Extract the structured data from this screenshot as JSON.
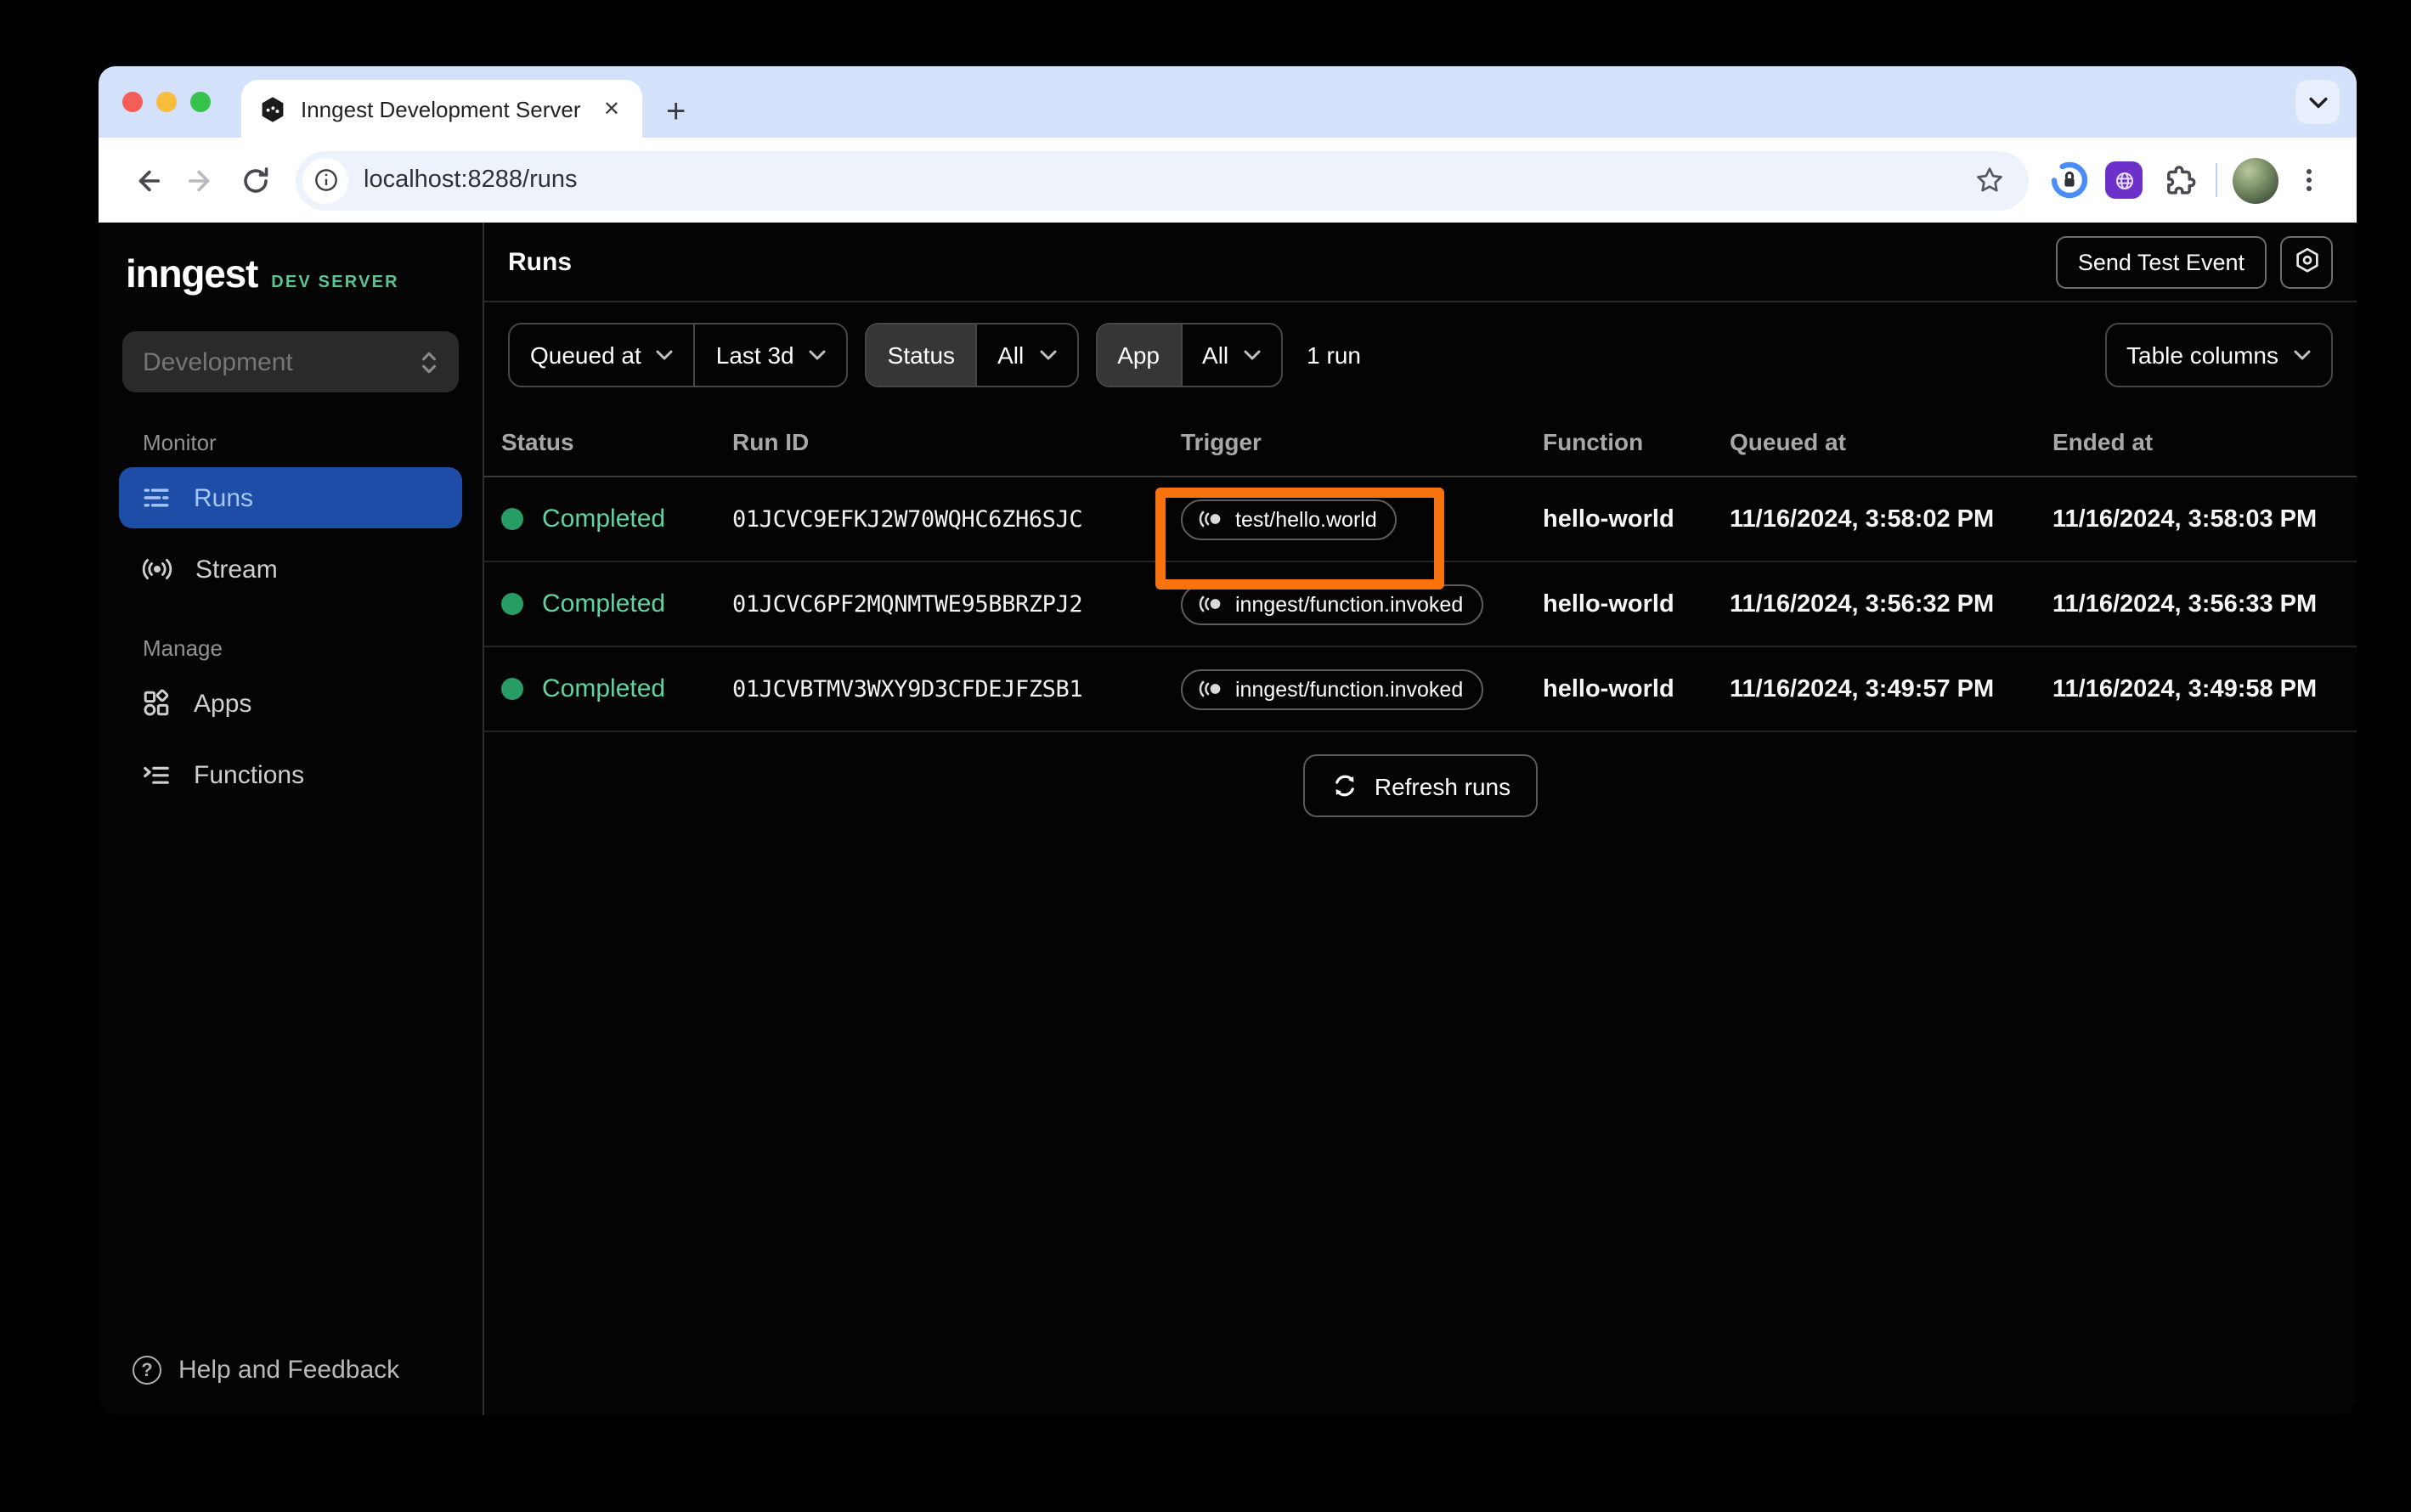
{
  "colors": {
    "accent_orange": "#f8730e",
    "active_item_blue": "#1d4da6",
    "status_green_text": "#5fd3a0",
    "status_dot_green": "#279c64",
    "brand_badge_green": "#5bc493",
    "tab_strip_blue": "#d4e1fb",
    "traffic_red": "#f35f58",
    "traffic_yellow": "#f6bd3c",
    "traffic_green": "#36c24d"
  },
  "browser": {
    "tab_title": "Inngest Development Server",
    "close_tab_glyph": "✕",
    "new_tab_glyph": "+",
    "url": "localhost:8288/runs"
  },
  "sidebar": {
    "logo": "inngest",
    "logo_badge": "DEV SERVER",
    "env_select_value": "Development",
    "section_monitor": "Monitor",
    "item_runs": "Runs",
    "item_stream": "Stream",
    "section_manage": "Manage",
    "item_apps": "Apps",
    "item_functions": "Functions",
    "help": "Help and Feedback",
    "help_glyph": "?"
  },
  "header": {
    "title": "Runs",
    "send_test_event": "Send Test Event"
  },
  "filters": {
    "queued_at": "Queued at",
    "range": "Last 3d",
    "status_label": "Status",
    "status_value": "All",
    "app_label": "App",
    "app_value": "All",
    "run_count": "1 run",
    "table_columns": "Table columns"
  },
  "table": {
    "columns": {
      "status": "Status",
      "run_id": "Run ID",
      "trigger": "Trigger",
      "function": "Function",
      "queued_at": "Queued at",
      "ended_at": "Ended at"
    },
    "rows": [
      {
        "status": "Completed",
        "run_id": "01JCVC9EFKJ2W70WQHC6ZH6SJC",
        "trigger": "test/hello.world",
        "function": "hello-world",
        "queued_at": "11/16/2024, 3:58:02 PM",
        "ended_at": "11/16/2024, 3:58:03 PM"
      },
      {
        "status": "Completed",
        "run_id": "01JCVC6PF2MQNMTWE95BBRZPJ2",
        "trigger": "inngest/function.invoked",
        "function": "hello-world",
        "queued_at": "11/16/2024, 3:56:32 PM",
        "ended_at": "11/16/2024, 3:56:33 PM"
      },
      {
        "status": "Completed",
        "run_id": "01JCVBTMV3WXY9D3CFDEJFZSB1",
        "trigger": "inngest/function.invoked",
        "function": "hello-world",
        "queued_at": "11/16/2024, 3:49:57 PM",
        "ended_at": "11/16/2024, 3:49:58 PM"
      }
    ],
    "refresh_label": "Refresh runs"
  }
}
